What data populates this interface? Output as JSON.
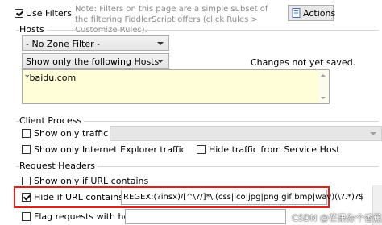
{
  "top": {
    "use_filters_label": "Use Filters",
    "use_filters_checked": true,
    "note": "Note: Filters on this page are a simple subset of the filtering FiddlerScript offers (click Rules > Customize Rules).",
    "actions_label": "Actions"
  },
  "hosts": {
    "group_label": "Hosts",
    "zone_filter_value": "- No Zone Filter -",
    "host_filter_value": "Show only the following Hosts",
    "status_text": "Changes not yet saved.",
    "hosts_text": "*baidu.com"
  },
  "client_process": {
    "group_label": "Client Process",
    "show_only_traffic_from_label": "Show only traffic from",
    "show_only_ie_label": "Show only Internet Explorer traffic",
    "hide_service_host_label": "Hide traffic from Service Host"
  },
  "request_headers": {
    "group_label": "Request Headers",
    "show_if_url_contains_label": "Show only if URL contains",
    "hide_if_url_contains_label": "Hide if URL contains",
    "hide_if_url_checked": true,
    "hide_if_url_value": "REGEX:(?insx)/[^\\?/]*\\.(css|ico|jpg|png|gif|bmp|wav)(\\?.*)?$",
    "flag_requests_label": "Flag requests with headers"
  },
  "watermark": "CSDN @芒果你个香蕉",
  "colors": {
    "highlight_border": "#e0201b",
    "hosts_textarea_bg": "#fffed8",
    "actions_bg": "#e9e9e9"
  },
  "icons": {
    "actions_icon": "actions-icon"
  }
}
